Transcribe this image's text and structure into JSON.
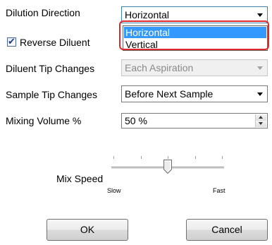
{
  "dilution_direction": {
    "label": "Dilution Direction",
    "value": "Horizontal",
    "options": [
      "Horizontal",
      "Vertical"
    ],
    "highlighted_option": "Horizontal"
  },
  "reverse_diluent": {
    "label": "Reverse Diluent",
    "checked": true
  },
  "diluent_tip_changes": {
    "label": "Diluent Tip Changes",
    "value": "Each Aspiration",
    "enabled": false
  },
  "sample_tip_changes": {
    "label": "Sample Tip Changes",
    "value": "Before Next Sample"
  },
  "mixing_volume": {
    "label": "Mixing Volume %",
    "value": "50 %"
  },
  "mix_speed": {
    "label": "Mix Speed",
    "min_label": "Slow",
    "max_label": "Fast",
    "level": 0.5
  },
  "buttons": {
    "ok": "OK",
    "cancel": "Cancel"
  },
  "colors": {
    "selection": "#3399ff",
    "highlight_box": "#e02a2a"
  }
}
